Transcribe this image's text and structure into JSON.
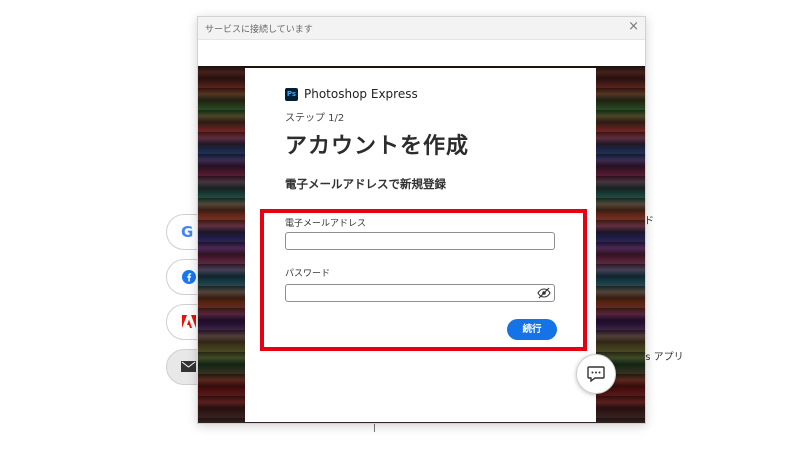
{
  "window": {
    "title": "サービスに接続しています",
    "close_icon": "close-icon"
  },
  "card": {
    "brand": "Photoshop Express",
    "brand_icon": "photoshop-express-icon",
    "step": "ステップ 1/2",
    "heading": "アカウントを作成",
    "subheading": "電子メールアドレスで新規登録",
    "email": {
      "label": "電子メールアドレス",
      "value": "",
      "placeholder": ""
    },
    "password": {
      "label": "パスワード",
      "value": "",
      "placeholder": "",
      "toggle_icon": "eye-slash-icon"
    },
    "continue_label": "続行"
  },
  "background": {
    "buttons": [
      {
        "icon": "google-icon"
      },
      {
        "icon": "facebook-icon"
      },
      {
        "icon": "adobe-icon"
      },
      {
        "icon": "email-icon"
      }
    ],
    "right_snippet_1": "ド",
    "right_snippet_2": "ss アプリ"
  },
  "chat_icon": "chat-icon",
  "colors": {
    "accent": "#1473e6",
    "highlight": "#e60012"
  }
}
